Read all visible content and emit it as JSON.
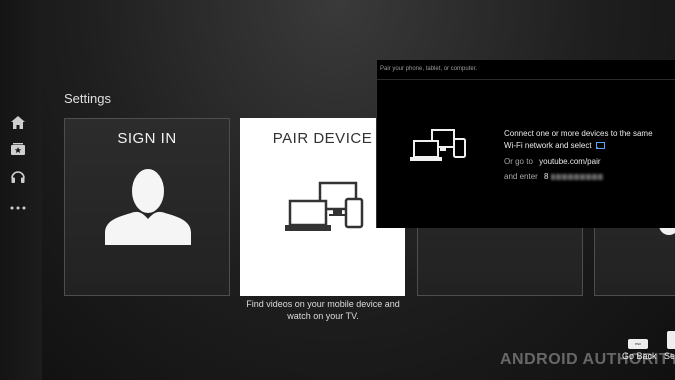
{
  "settings_title": "Settings",
  "nav": [
    {
      "icon": "home-icon"
    },
    {
      "icon": "subscriptions-icon"
    },
    {
      "icon": "headphones-icon"
    },
    {
      "icon": "more-icon"
    }
  ],
  "tiles": [
    {
      "label": "SIGN IN",
      "icon": "user-avatar-icon"
    },
    {
      "label": "PAIR DEVICE",
      "icon": "devices-icon",
      "description": "Find videos on your mobile device and watch on your TV."
    },
    {
      "label": ""
    },
    {
      "label": ""
    }
  ],
  "popup": {
    "header": "Pair your phone, tablet, or computer.",
    "line1": "Connect one or more devices to the same",
    "line2": "Wi-Fi network and select",
    "or_go_to": "Or go to",
    "url": "youtube.com/pair",
    "and_enter": "and enter",
    "code_prefix": "8"
  },
  "hints": {
    "back_key": "esc",
    "back_label": "Go Back",
    "select_label": "Se"
  },
  "watermark": "ANDROID AUTHORITY"
}
